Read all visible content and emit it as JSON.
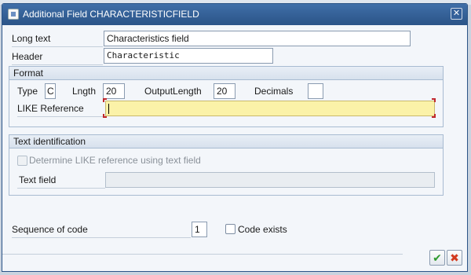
{
  "dialog": {
    "title": "Additional Field CHARACTERISTICFIELD",
    "close_icon": "close-icon"
  },
  "fields": {
    "long_text_label": "Long text",
    "long_text_value": "Characteristics field",
    "header_label": "Header",
    "header_value": "Characteristic"
  },
  "format_group": {
    "title": "Format",
    "type_label": "Type",
    "type_value": "C",
    "length_label": "Lngth",
    "length_value": "20",
    "output_length_label": "OutputLength",
    "output_length_value": "20",
    "decimals_label": "Decimals",
    "decimals_value": "",
    "like_reference_label": "LIKE Reference",
    "like_reference_value": ""
  },
  "text_identification_group": {
    "title": "Text identification",
    "determine_like_label": "Determine LIKE reference using text field",
    "determine_like_checked": false,
    "text_field_label": "Text field",
    "text_field_value": ""
  },
  "sequence": {
    "label": "Sequence of code",
    "value": "1",
    "code_exists_label": "Code exists",
    "code_exists_checked": false
  },
  "buttons": {
    "ok_icon": "checkmark-icon",
    "cancel_icon": "cancel-x-icon"
  },
  "colors": {
    "titlebar": "#2b5487",
    "required_field": "#fbf2a8",
    "ok": "#2f9a2f",
    "cancel": "#d33a1f"
  }
}
